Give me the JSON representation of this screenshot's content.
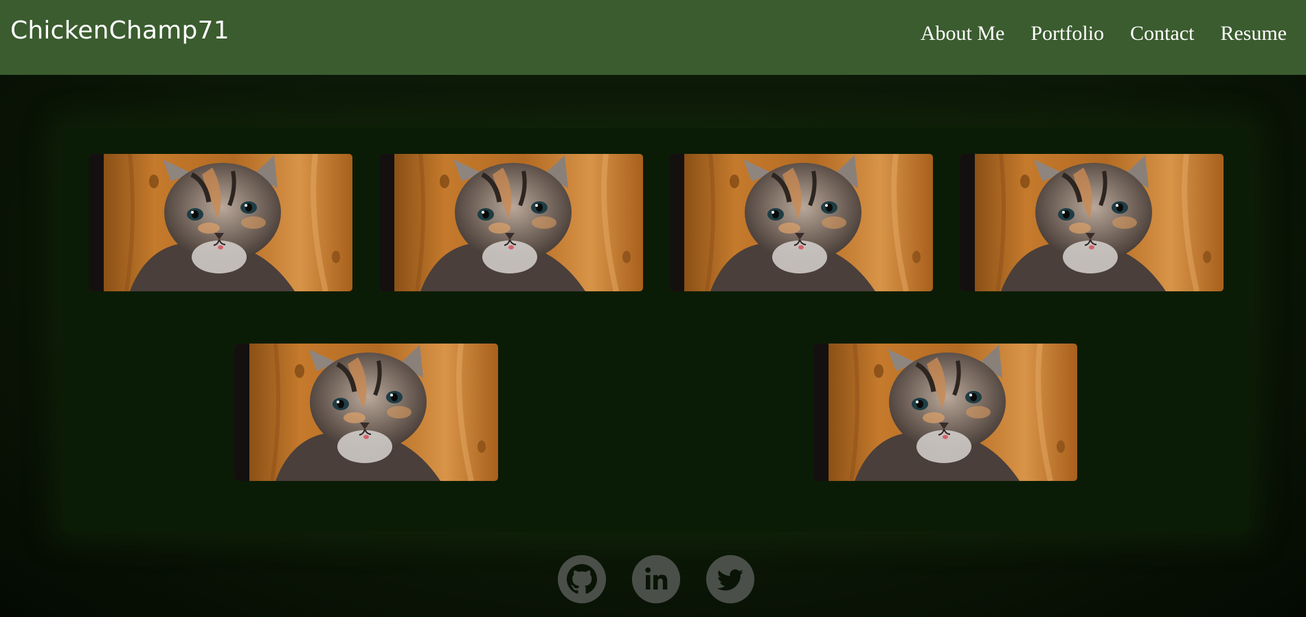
{
  "header": {
    "brand": "ChickenChamp71",
    "nav": [
      "About Me",
      "Portfolio",
      "Contact",
      "Resume"
    ]
  },
  "gallery": {
    "items": [
      {
        "image": "kitten-photo"
      },
      {
        "image": "kitten-photo"
      },
      {
        "image": "kitten-photo"
      },
      {
        "image": "kitten-photo"
      },
      {
        "image": "kitten-photo"
      },
      {
        "image": "kitten-photo"
      }
    ]
  },
  "footer": {
    "icons": [
      "github-icon",
      "linkedin-icon",
      "twitter-icon"
    ]
  },
  "colors": {
    "header": "#3b5c2f",
    "background": "#0c1807",
    "panel": "#0b1c06",
    "icon": "#4a4f49"
  }
}
